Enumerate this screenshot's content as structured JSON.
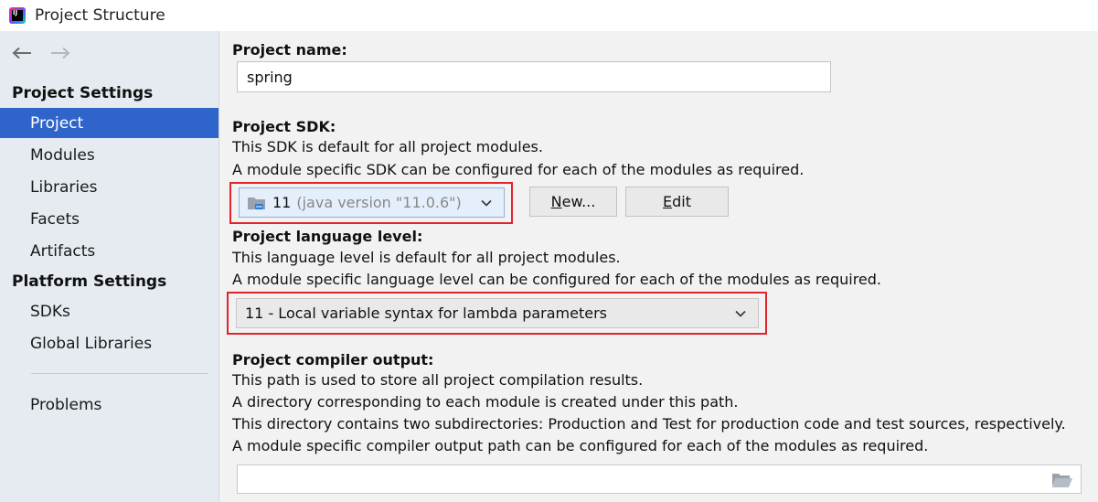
{
  "window": {
    "title": "Project Structure",
    "icon": "intellij-idea-icon"
  },
  "nav": {
    "back_icon": "arrow-left-icon",
    "forward_icon": "arrow-right-icon"
  },
  "sidebar": {
    "project_settings_header": "Project Settings",
    "project_settings_items": [
      {
        "label": "Project",
        "selected": true
      },
      {
        "label": "Modules"
      },
      {
        "label": "Libraries"
      },
      {
        "label": "Facets"
      },
      {
        "label": "Artifacts"
      }
    ],
    "platform_settings_header": "Platform Settings",
    "platform_settings_items": [
      {
        "label": "SDKs"
      },
      {
        "label": "Global Libraries"
      }
    ],
    "problems_label": "Problems"
  },
  "main": {
    "project_name": {
      "label": "Project name:",
      "value": "spring"
    },
    "project_sdk": {
      "label": "Project SDK:",
      "desc1": "This SDK is default for all project modules.",
      "desc2": "A module specific SDK can be configured for each of the modules as required.",
      "selected_main": "11",
      "selected_sub": "(java version \"11.0.6\")",
      "new_button": {
        "mnemonic": "N",
        "rest": "ew..."
      },
      "edit_button": {
        "mnemonic": "E",
        "rest": "dit"
      }
    },
    "language_level": {
      "label": "Project language level:",
      "desc1": "This language level is default for all project modules.",
      "desc2": "A module specific language level can be configured for each of the modules as required.",
      "selected": "11 - Local variable syntax for lambda parameters"
    },
    "compiler_output": {
      "label": "Project compiler output:",
      "desc1": "This path is used to store all project compilation results.",
      "desc2": "A directory corresponding to each module is created under this path.",
      "desc3": "This directory contains two subdirectories: Production and Test for production code and test sources, respectively.",
      "desc4": "A module specific compiler output path can be configured for each of the modules as required.",
      "value": ""
    }
  },
  "colors": {
    "selection": "#2f65ca",
    "highlight": "#e0242a",
    "sidebar_bg": "#e6ebf2"
  }
}
